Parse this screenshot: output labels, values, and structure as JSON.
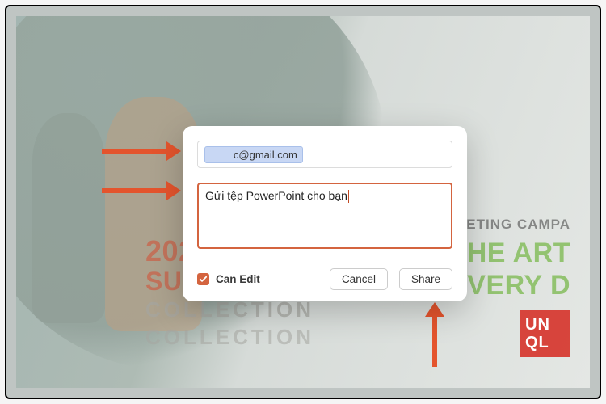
{
  "background": {
    "year": "202",
    "summer": "SU",
    "collection1": "COLLECTION",
    "collection2": "COLLECTION",
    "marketing": "MARKETING CAMPA",
    "art": "THE ART",
    "every": "EVERY D",
    "logo_line1": "UN",
    "logo_line2": "QL"
  },
  "dialog": {
    "email_chip": "        c@gmail.com",
    "message_value": "Gửi tệp PowerPoint cho bạn",
    "can_edit_label": "Can Edit",
    "cancel_label": "Cancel",
    "share_label": "Share"
  }
}
